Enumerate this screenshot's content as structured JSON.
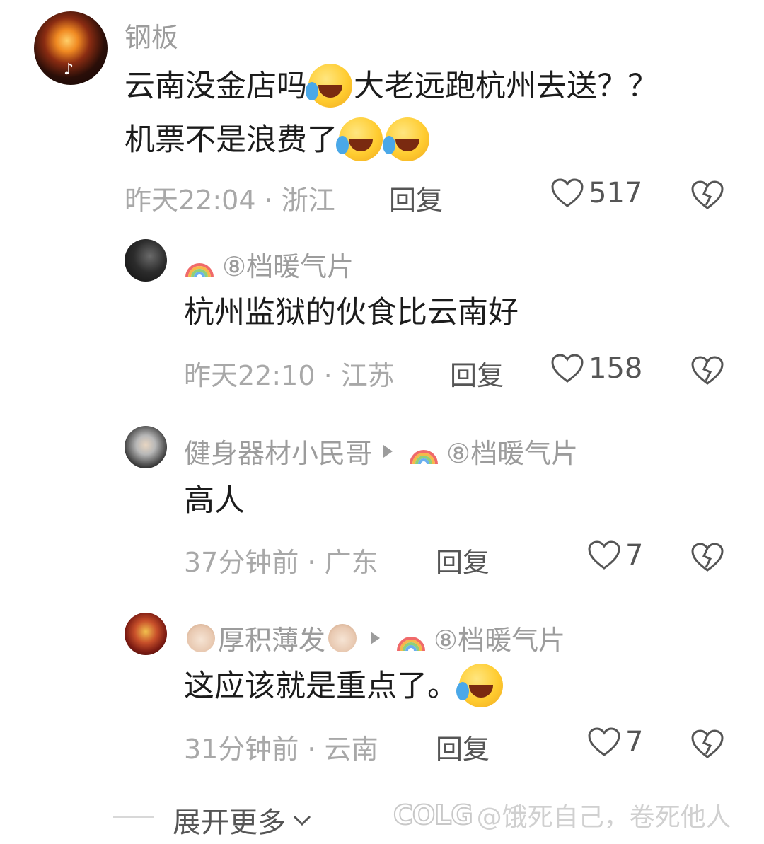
{
  "comments": [
    {
      "username": "钢板",
      "text_line1_a": "云南没金店吗",
      "text_line1_b": "大老远跑杭州去送？？",
      "text_line2_a": "机票不是浪费了",
      "time_location": "昨天22:04 · 浙江",
      "reply_label": "回复",
      "likes": "517"
    }
  ],
  "replies": [
    {
      "username": "⑧档暖气片",
      "text": "杭州监狱的伙食比云南好",
      "time_location": "昨天22:10 · 江苏",
      "reply_label": "回复",
      "likes": "158"
    },
    {
      "username": "健身器材小民哥",
      "reply_to": "⑧档暖气片",
      "text": "高人",
      "time_location": "37分钟前 · 广东",
      "reply_label": "回复",
      "likes": "7"
    },
    {
      "username": "厚积薄发",
      "reply_to": "⑧档暖气片",
      "text": "这应该就是重点了。",
      "time_location": "31分钟前 · 云南",
      "reply_label": "回复",
      "likes": "7"
    }
  ],
  "footer": {
    "expand_label": "展开更多",
    "watermark_logo": "COLG",
    "watermark_text": "@饿死自己，卷死他人"
  },
  "icons": {
    "like": "heart-outline-icon",
    "dislike": "broken-heart-icon",
    "rainbow": "rainbow-icon",
    "emoji": "laughing-crying-emoji-icon",
    "cow": "cow-face-emoji-icon",
    "tiktok": "tiktok-logo-icon"
  }
}
